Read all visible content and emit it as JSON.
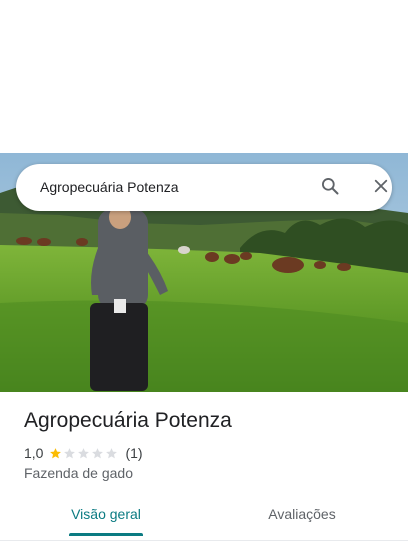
{
  "search": {
    "query": "Agropecuária Potenza",
    "search_icon": "search-icon",
    "close_icon": "close-icon"
  },
  "place": {
    "name": "Agropecuária Potenza",
    "rating": "1,0",
    "stars_filled": 1,
    "stars_total": 5,
    "review_count": "(1)",
    "category": "Fazenda de gado"
  },
  "tabs": [
    {
      "label": "Visão geral",
      "active": true
    },
    {
      "label": "Avaliações",
      "active": false
    }
  ],
  "colors": {
    "accent": "#0b7b82",
    "star_filled": "#fbbc04",
    "star_empty": "#dadce0"
  }
}
